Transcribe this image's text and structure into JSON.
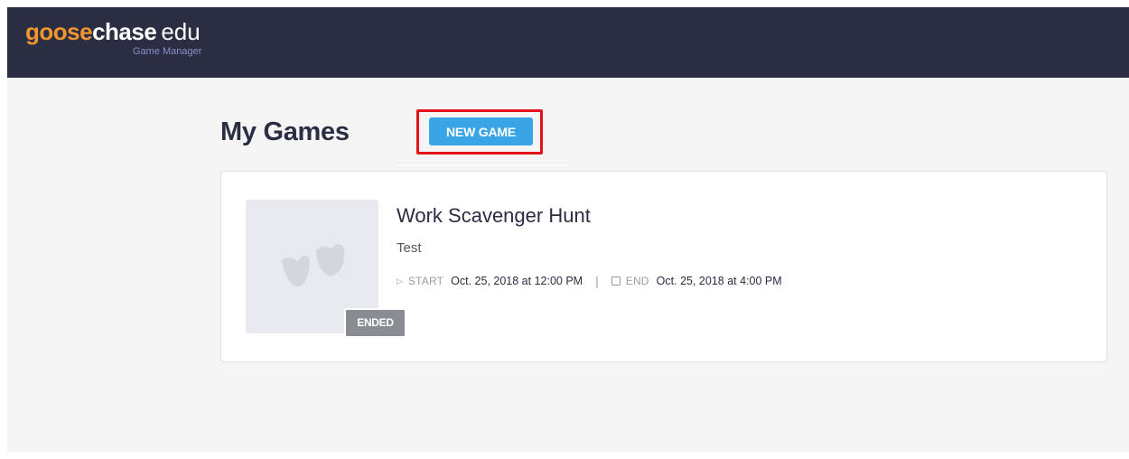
{
  "header": {
    "brand_goose": "goose",
    "brand_chase": "chase",
    "brand_edu": "edu",
    "brand_subtitle": "Game Manager"
  },
  "page": {
    "title": "My Games",
    "new_game_label": "NEW GAME"
  },
  "games": [
    {
      "title": "Work Scavenger Hunt",
      "description": "Test",
      "status": "ENDED",
      "start_label": "START",
      "start_value": "Oct. 25, 2018 at 12:00 PM",
      "end_label": "END",
      "end_value": "Oct. 25, 2018 at 4:00 PM",
      "separator": "|"
    }
  ],
  "colors": {
    "topbar": "#2b2d42",
    "brand_orange": "#f0962e",
    "accent_blue": "#3aa5e6",
    "highlight_red": "#e3121b",
    "badge_gray": "#8a8c93"
  },
  "icons": {
    "thumbnail": "goose-footprints-icon",
    "start": "play-triangle-icon",
    "end": "stop-square-icon"
  }
}
